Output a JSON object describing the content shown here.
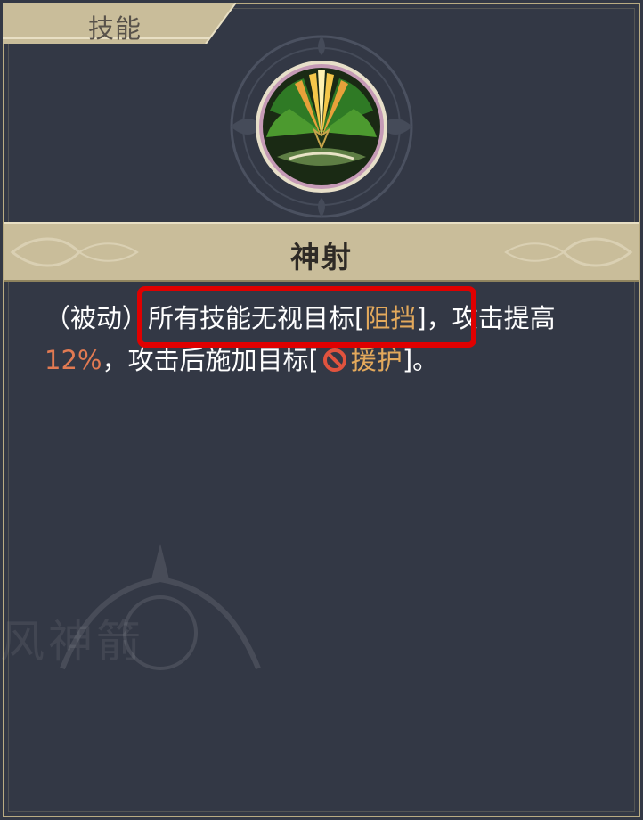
{
  "tab": {
    "label": "技能"
  },
  "skill": {
    "name": "神射"
  },
  "description": {
    "part1": "（被动）",
    "part2": "所有技能无视目标[",
    "keyword1": "阻挡",
    "part3": "]，攻击提高",
    "value": "12%",
    "part4": "，攻击后施加目标[",
    "keyword2": "援护",
    "part5": "]。"
  },
  "watermark": {
    "text": "风神箭"
  },
  "colors": {
    "panel_bg": "#333845",
    "gold_border": "#b9ab82",
    "title_band": "#c9bd9a",
    "keyword": "#e3a95c",
    "number": "#e27a52",
    "highlight": "#e00000"
  },
  "icons": {
    "skill": "green-arrow-burst-icon",
    "debuff": "prohibited-icon"
  }
}
